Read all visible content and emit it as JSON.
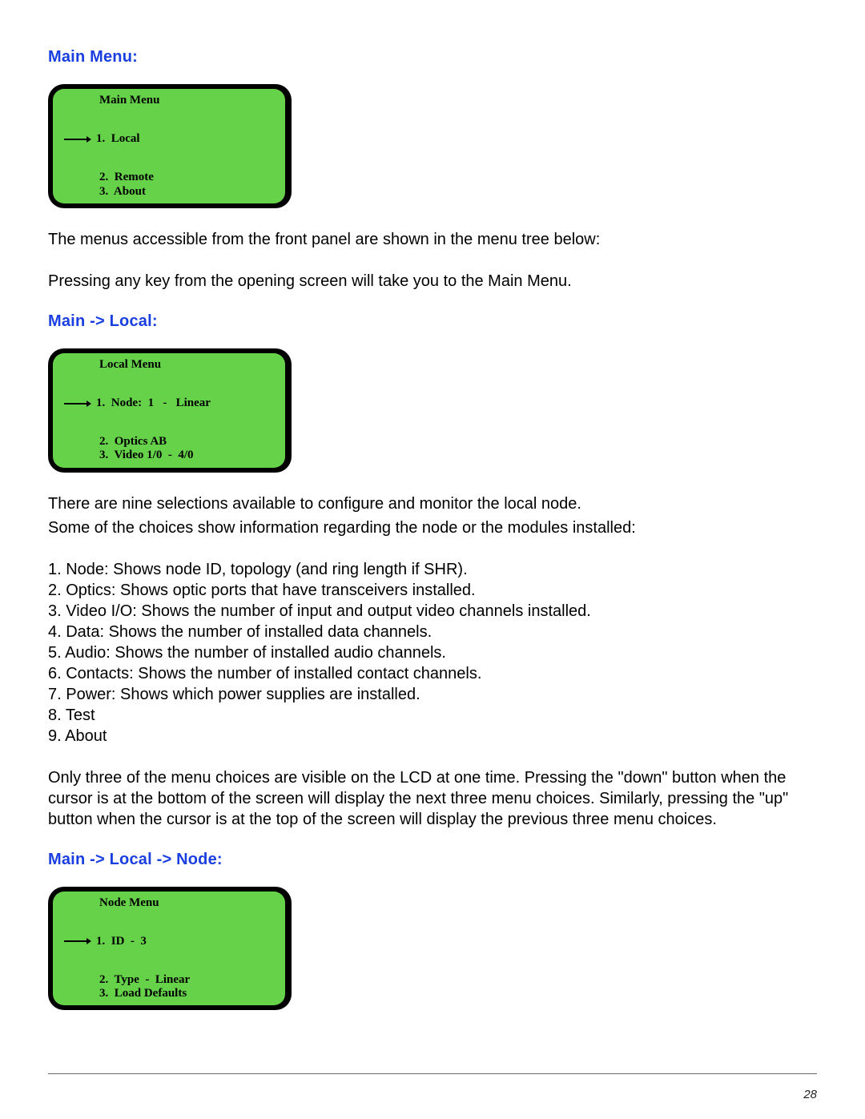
{
  "headings": {
    "main_menu": "Main Menu:",
    "main_local": "Main -> Local:",
    "main_local_node": "Main -> Local -> Node:"
  },
  "lcds": {
    "main": {
      "title": "Main Menu",
      "item1": "1.  Local",
      "item2": "2.  Remote",
      "item3": "3.  About"
    },
    "local": {
      "title": "Local Menu",
      "item1": "1.  Node:  1   -   Linear",
      "item2": "2.  Optics AB",
      "item3": "3.  Video 1/0  -  4/0"
    },
    "node": {
      "title": "Node Menu",
      "item1": "1.  ID  -  3",
      "item2": "2.  Type  -  Linear",
      "item3": "3.  Load Defaults"
    }
  },
  "paragraphs": {
    "p1": "The menus accessible from the front panel are shown in the menu tree below:",
    "p2": "Pressing any key from the opening screen will take you to the Main Menu.",
    "p3a": "There are nine selections available to configure and monitor the local node.",
    "p3b": "Some of the choices show information regarding the node or the modules installed:",
    "p4": "Only three of the menu choices are visible on the LCD at one time. Pressing the \"down\" button when the cursor is at the bottom of the screen will display the next three menu choices. Similarly, pressing the \"up\" button when the cursor is at the top of the screen will display the previous three menu choices."
  },
  "list": {
    "i1": "1. Node: Shows node ID, topology (and ring length if SHR).",
    "i2": "2. Optics: Shows optic ports that have transceivers installed.",
    "i3": "3. Video I/O: Shows the number of input and output video channels installed.",
    "i4": "4. Data: Shows the number of installed data channels.",
    "i5": "5. Audio: Shows the number of installed audio channels.",
    "i6": "6. Contacts: Shows the number of installed contact channels.",
    "i7": "7. Power: Shows which power supplies are installed.",
    "i8": "8. Test",
    "i9": "9. About"
  },
  "page_number": "28"
}
